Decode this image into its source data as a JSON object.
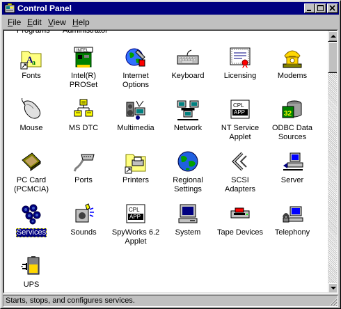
{
  "window": {
    "title": "Control Panel"
  },
  "menu": [
    {
      "accel": "F",
      "rest": "ile"
    },
    {
      "accel": "E",
      "rest": "dit"
    },
    {
      "accel": "V",
      "rest": "iew"
    },
    {
      "accel": "H",
      "rest": "elp"
    }
  ],
  "partial_row": [
    "Programs",
    "Administrator"
  ],
  "items": [
    {
      "label": "Fonts",
      "icon": "fonts-folder-icon"
    },
    {
      "label": "Intel(R) PROSet",
      "icon": "network-card-icon"
    },
    {
      "label": "Internet Options",
      "icon": "internet-globe-icon"
    },
    {
      "label": "Keyboard",
      "icon": "keyboard-icon"
    },
    {
      "label": "Licensing",
      "icon": "certificate-icon"
    },
    {
      "label": "Modems",
      "icon": "telephone-modem-icon"
    },
    {
      "label": "Mouse",
      "icon": "mouse-icon"
    },
    {
      "label": "MS DTC",
      "icon": "dtc-icon"
    },
    {
      "label": "Multimedia",
      "icon": "multimedia-icon"
    },
    {
      "label": "Network",
      "icon": "network-computers-icon"
    },
    {
      "label": "NT Service Applet",
      "icon": "cpl-applet-icon"
    },
    {
      "label": "ODBC Data Sources",
      "icon": "odbc-icon"
    },
    {
      "label": "PC Card (PCMCIA)",
      "icon": "pc-card-icon"
    },
    {
      "label": "Ports",
      "icon": "serial-port-icon"
    },
    {
      "label": "Printers",
      "icon": "printers-folder-icon"
    },
    {
      "label": "Regional Settings",
      "icon": "regional-globe-icon"
    },
    {
      "label": "SCSI Adapters",
      "icon": "scsi-icon"
    },
    {
      "label": "Server",
      "icon": "server-icon"
    },
    {
      "label": "Services",
      "icon": "services-gears-icon",
      "selected": true
    },
    {
      "label": "Sounds",
      "icon": "speaker-icon"
    },
    {
      "label": "SpyWorks 6.2 Applet",
      "icon": "cpl-applet-icon"
    },
    {
      "label": "System",
      "icon": "computer-icon"
    },
    {
      "label": "Tape Devices",
      "icon": "tape-drive-icon"
    },
    {
      "label": "Telephony",
      "icon": "telephony-icon"
    },
    {
      "label": "UPS",
      "icon": "battery-icon"
    }
  ],
  "icon_text": {
    "cpl_line1": "CPL",
    "cpl_line2": "APP"
  },
  "status": {
    "text": "Starts, stops, and configures services."
  },
  "colors": {
    "titlebar": "#000080",
    "face": "#c0c0c0",
    "selection": "#000080"
  }
}
